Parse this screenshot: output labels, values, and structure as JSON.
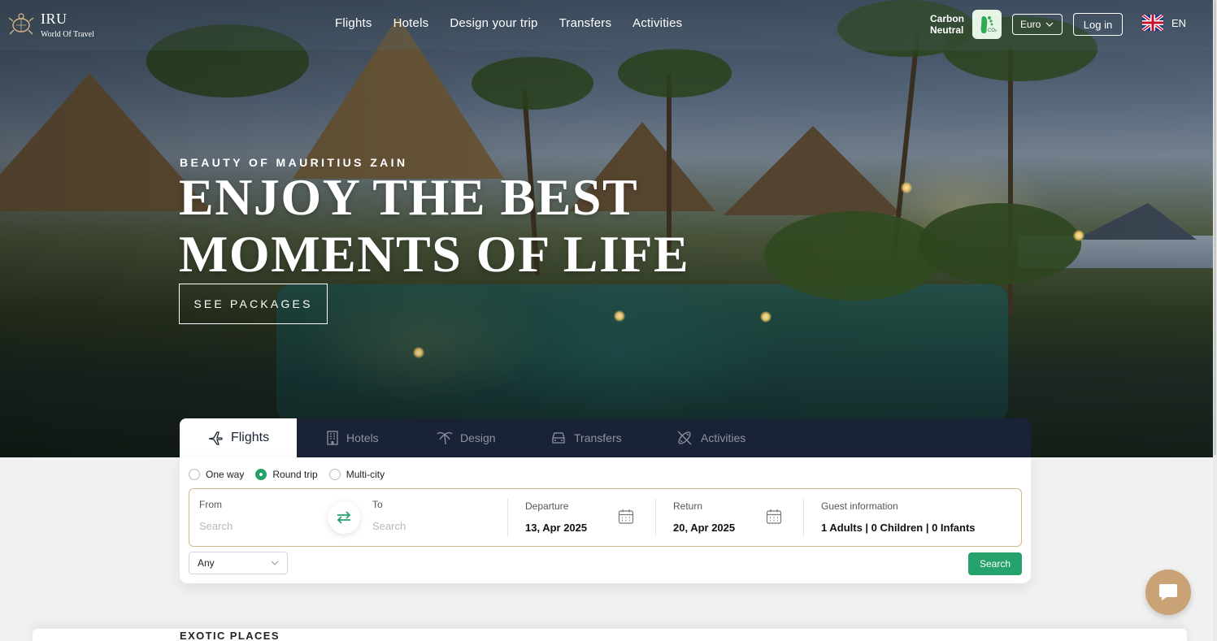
{
  "brand": {
    "title": "IRU",
    "subtitle": "World Of Travel"
  },
  "nav": {
    "links": [
      "Flights",
      "Hotels",
      "Design your trip",
      "Transfers",
      "Activities"
    ],
    "carbon_line1": "Carbon",
    "carbon_line2": "Neutral",
    "carbon_badge_text": "CO₂",
    "currency": "Euro",
    "login": "Log in",
    "language": "EN"
  },
  "hero": {
    "eyebrow": "BEAUTY OF MAURITIUS ZAIN",
    "headline_line1": "ENJOY THE BEST",
    "headline_line2": "MOMENTS OF LIFE",
    "cta": "SEE PACKAGES"
  },
  "search": {
    "tabs": [
      {
        "label": "Flights",
        "icon": "plane-icon",
        "active": true
      },
      {
        "label": "Hotels",
        "icon": "building-icon",
        "active": false
      },
      {
        "label": "Design",
        "icon": "palm-icon",
        "active": false
      },
      {
        "label": "Transfers",
        "icon": "car-icon",
        "active": false
      },
      {
        "label": "Activities",
        "icon": "activity-icon",
        "active": false
      }
    ],
    "trip_types": [
      "One way",
      "Round trip",
      "Multi-city"
    ],
    "selected_trip_type": "Round trip",
    "from_label": "From",
    "from_placeholder": "Search",
    "to_label": "To",
    "to_placeholder": "Search",
    "departure_label": "Departure",
    "departure_value": "13, Apr 2025",
    "return_label": "Return",
    "return_value": "20, Apr 2025",
    "guest_label": "Guest information",
    "guest_value": "1 Adults | 0 Children | 0 Infants",
    "cabin_value": "Any",
    "search_button": "Search"
  },
  "section": {
    "title": "EXOTIC PLACES"
  },
  "colors": {
    "accent_green": "#26a36c",
    "tab_bar": "#1a2335",
    "field_border": "#d8b68a",
    "chat_bubble": "#c9a276"
  }
}
